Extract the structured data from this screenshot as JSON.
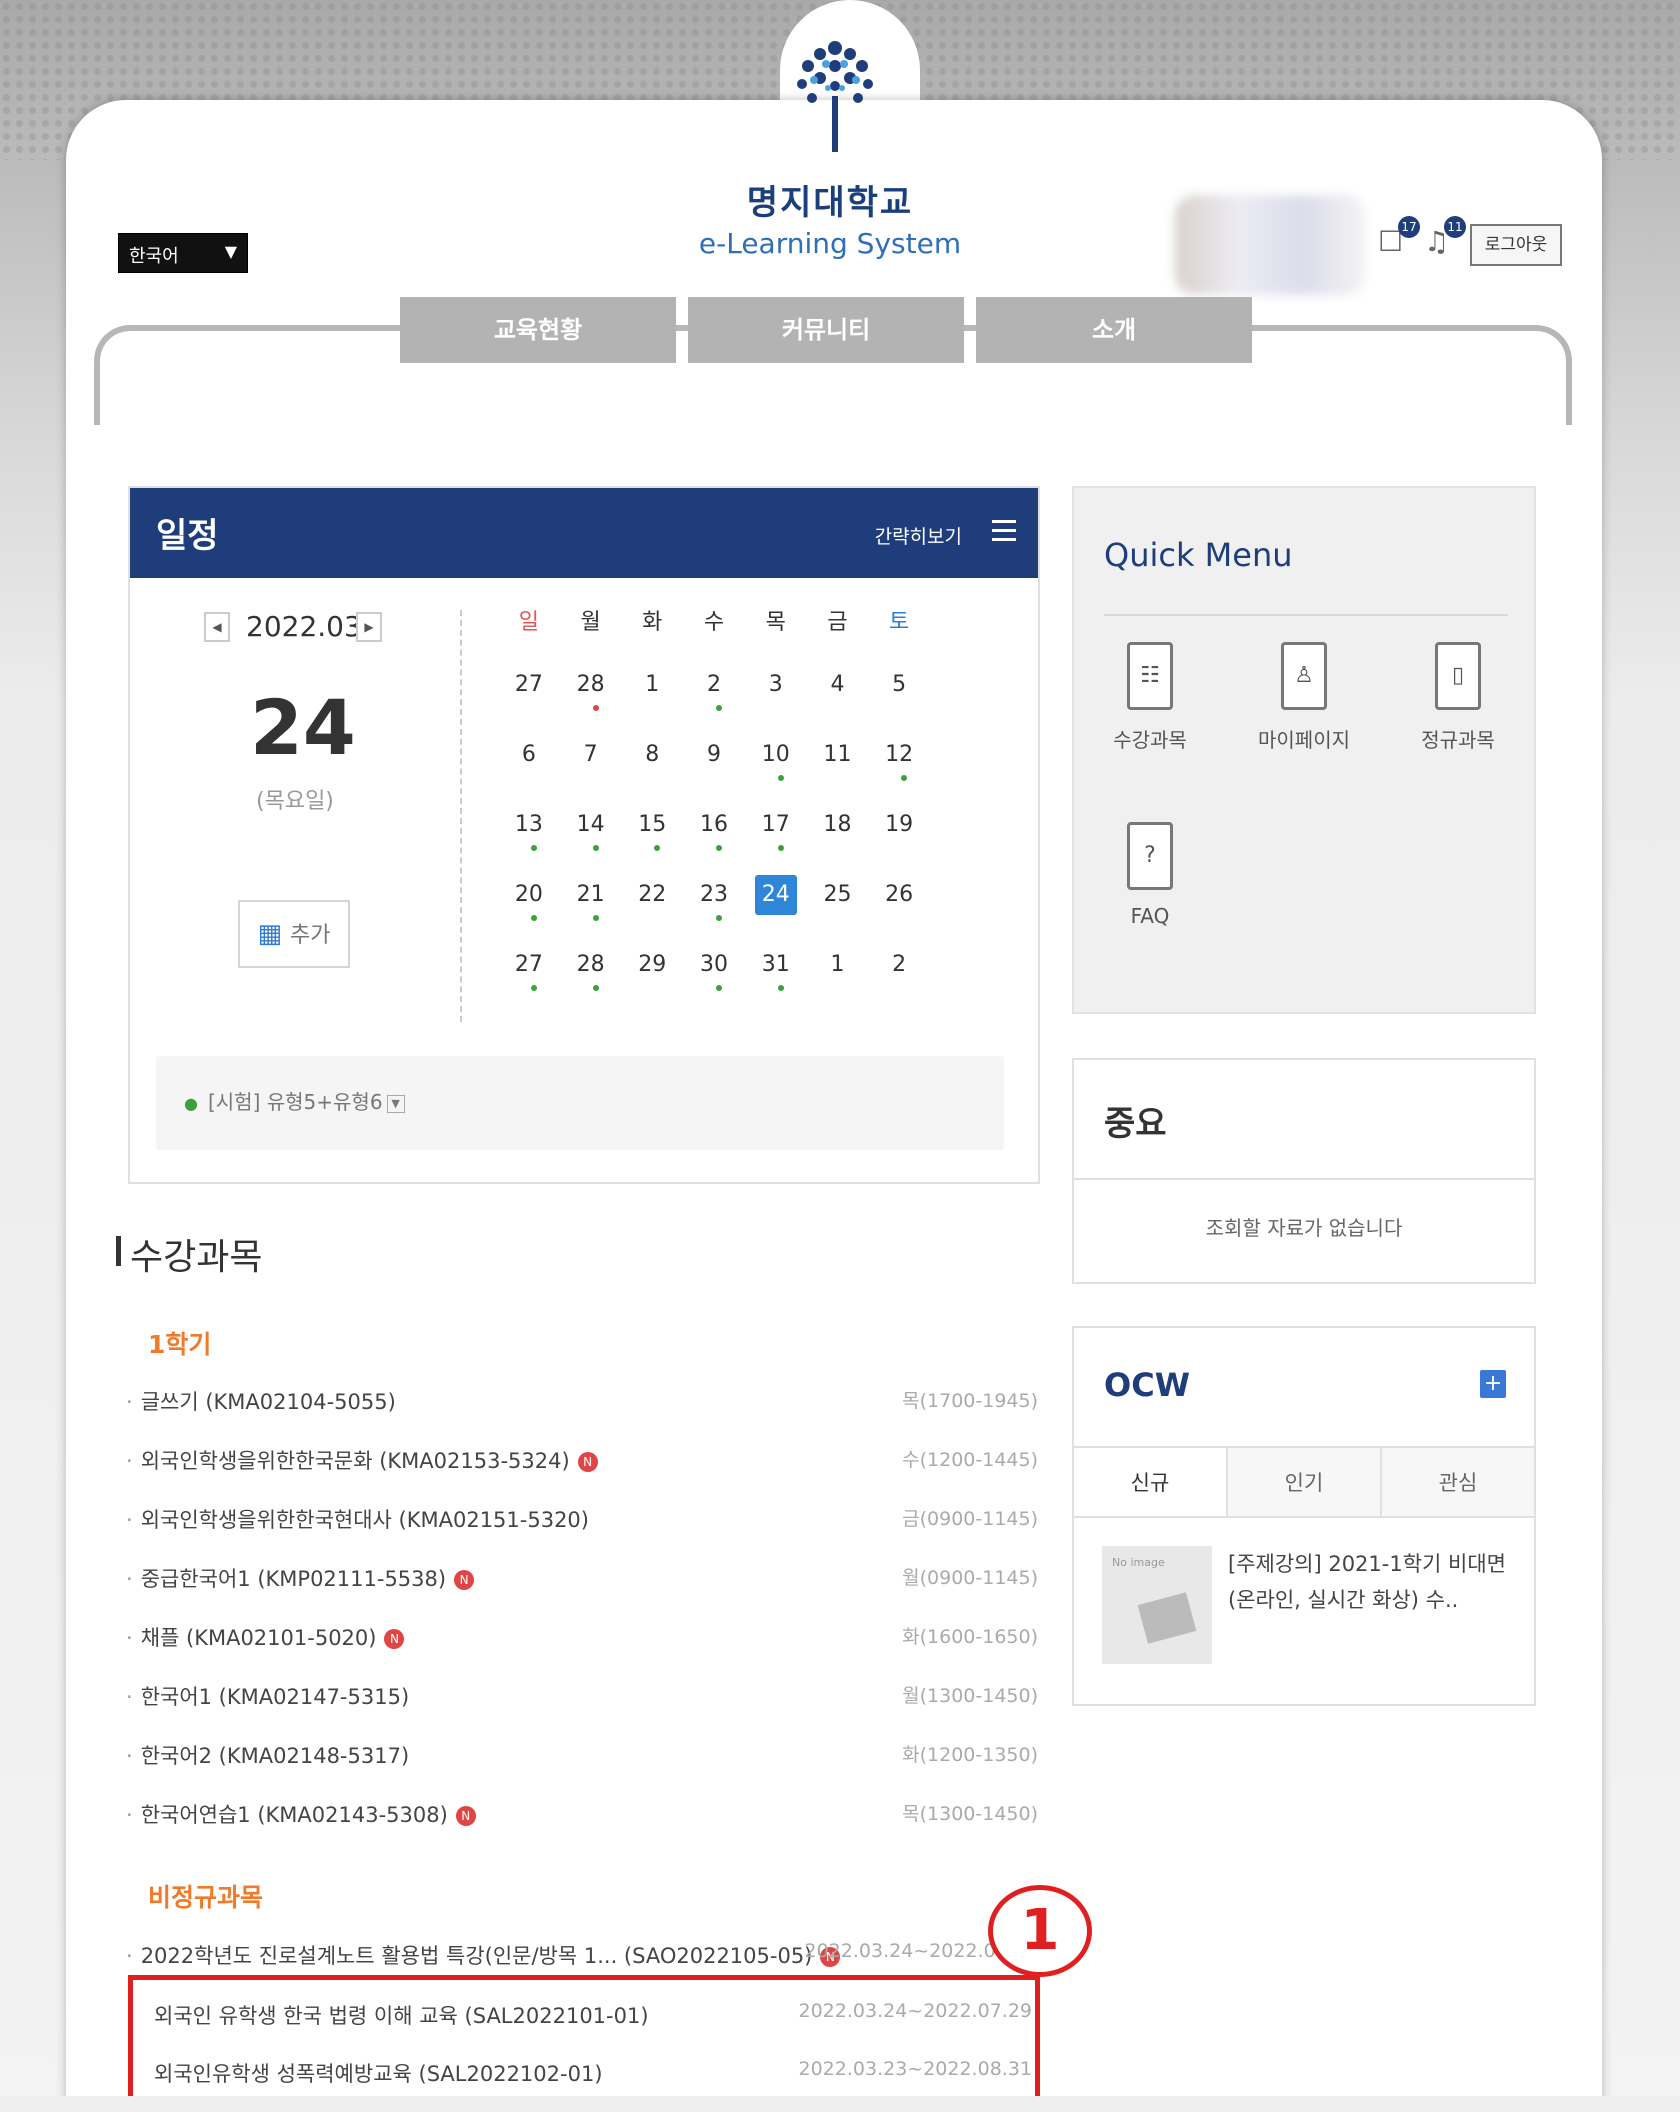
{
  "header": {
    "logo_name": "명지대학교",
    "logo_sub": "e-Learning System",
    "language": "한국어",
    "message_count": "17",
    "alarm_count": "11",
    "logout": "로그아웃",
    "tabs": [
      "교육현황",
      "커뮤니티",
      "소개"
    ]
  },
  "schedule": {
    "title": "일정",
    "toggle": "간략히보기",
    "month": "2022.03",
    "day": "24",
    "weekday": "(목요일)",
    "add": "추가",
    "weekday_headers": [
      "일",
      "월",
      "화",
      "수",
      "목",
      "금",
      "토"
    ],
    "weeks": [
      [
        "27",
        "28",
        "1",
        "2",
        "3",
        "4",
        "5"
      ],
      [
        "6",
        "7",
        "8",
        "9",
        "10",
        "11",
        "12"
      ],
      [
        "13",
        "14",
        "15",
        "16",
        "17",
        "18",
        "19"
      ],
      [
        "20",
        "21",
        "22",
        "23",
        "24",
        "25",
        "26"
      ],
      [
        "27",
        "28",
        "29",
        "30",
        "31",
        "1",
        "2"
      ]
    ],
    "event": "[시험] 유형5+유형6"
  },
  "courses": {
    "title": "수강과목",
    "regular_label": "1학기",
    "regular": [
      {
        "name": "글쓰기 (KMA02104-5055)",
        "time": "목(1700-1945)",
        "new": false
      },
      {
        "name": "외국인학생을위한한국문화 (KMA02153-5324)",
        "time": "수(1200-1445)",
        "new": true
      },
      {
        "name": "외국인학생을위한한국현대사 (KMA02151-5320)",
        "time": "금(0900-1145)",
        "new": false
      },
      {
        "name": "중급한국어1 (KMP02111-5538)",
        "time": "월(0900-1145)",
        "new": true
      },
      {
        "name": "채플 (KMA02101-5020)",
        "time": "화(1600-1650)",
        "new": true
      },
      {
        "name": "한국어1 (KMA02147-5315)",
        "time": "월(1300-1450)",
        "new": false
      },
      {
        "name": "한국어2 (KMA02148-5317)",
        "time": "화(1200-1350)",
        "new": false
      },
      {
        "name": "한국어연습1 (KMA02143-5308)",
        "time": "목(1300-1450)",
        "new": true
      }
    ],
    "irregular_label": "비정규과목",
    "irregular": [
      {
        "name": "2022학년도 진로설계노트 활용법 특강(인문/방목 1... (SAO2022105-05)",
        "time": "2022.03.24~2022.06.30",
        "new": true
      },
      {
        "name": "외국인 유학생 한국 법령 이해 교육 (SAL2022101-01)",
        "time": "2022.03.24~2022.07.29",
        "new": false
      },
      {
        "name": "외국인유학생 성폭력예방교육 (SAL2022102-01)",
        "time": "2022.03.23~2022.08.31",
        "new": false
      }
    ],
    "new_badge": "N",
    "callout_number": "1"
  },
  "quick_menu": {
    "title": "Quick Menu",
    "items": [
      "수강과목",
      "마이페이지",
      "정규과목",
      "FAQ"
    ]
  },
  "important": {
    "title": "중요",
    "empty": "조회할 자료가 없습니다"
  },
  "ocw": {
    "title": "OCW",
    "tabs": [
      "신규",
      "인기",
      "관심"
    ],
    "thumb_label": "No image",
    "item_title": "[주제강의] 2021-1학기 비대면 (온라인, 실시간 화상) 수.."
  },
  "colors": {
    "primary": "#1f3d7b",
    "accent_orange": "#f07a2a",
    "today_blue": "#2f86d9",
    "highlight_red": "#e02020"
  }
}
